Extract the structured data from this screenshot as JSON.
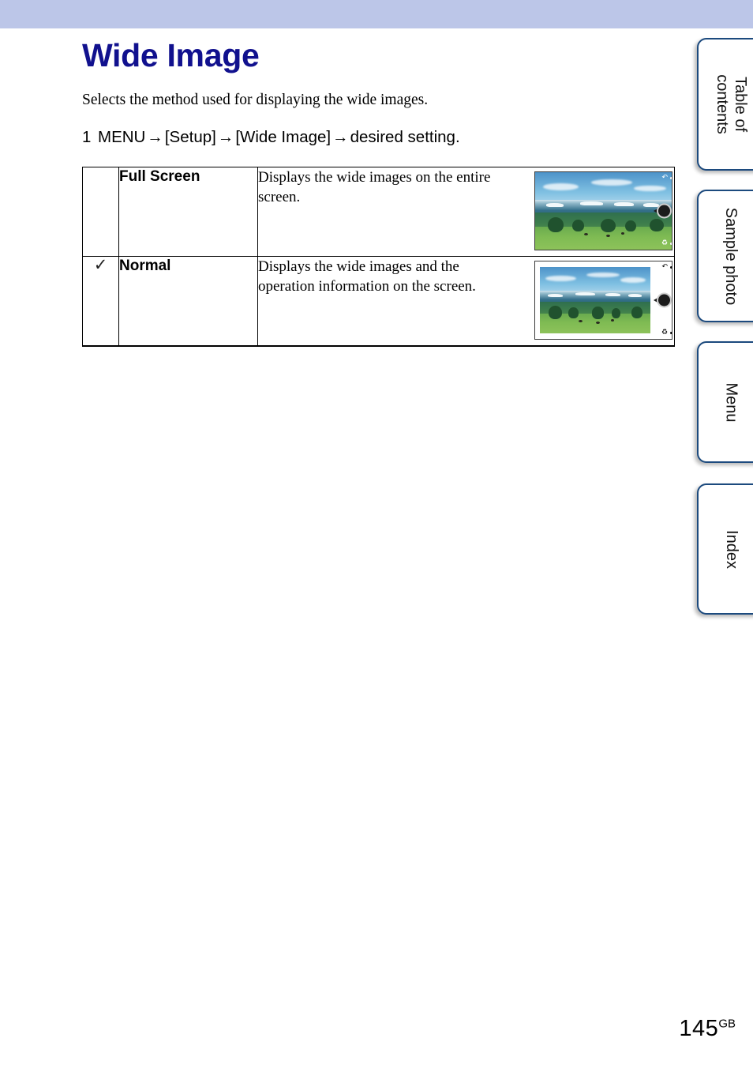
{
  "header": {
    "bar_color": "#bcc6e8"
  },
  "page": {
    "title": "Wide Image",
    "title_color": "#11118e",
    "intro": "Selects the method used for displaying the wide images.",
    "step": {
      "number": "1",
      "parts": [
        "MENU",
        "[Setup]",
        "[Wide Image]",
        "desired setting."
      ],
      "arrow": "→"
    },
    "number_label": "145",
    "number_suffix": "GB"
  },
  "table": {
    "check_glyph": "✓",
    "rows": [
      {
        "checked": "",
        "name": "Full Screen",
        "description": "Displays the wide images on the entire screen.",
        "thumbnail_mode": "full",
        "icons": {
          "back": "↶",
          "trash": "Ὕ1",
          "wheel": "control-wheel"
        }
      },
      {
        "checked": "✓",
        "name": "Normal",
        "description": "Displays the wide images and the operation information on the screen.",
        "thumbnail_mode": "normal",
        "icons": {
          "back": "↶",
          "trash": "Ὕ1",
          "wheel": "control-wheel"
        }
      }
    ]
  },
  "tabs": [
    {
      "label": "Table of\ncontents",
      "line1": "Table of",
      "line2": "contents"
    },
    {
      "label": "Sample photo",
      "line1": "Sample photo",
      "line2": ""
    },
    {
      "label": "Menu",
      "line1": "Menu",
      "line2": ""
    },
    {
      "label": "Index",
      "line1": "Index",
      "line2": ""
    }
  ]
}
